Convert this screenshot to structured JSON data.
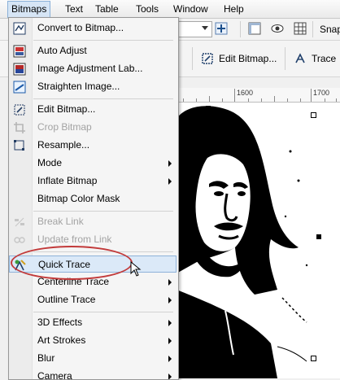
{
  "menubar": {
    "items": [
      {
        "label": "Bitmaps",
        "active": true
      },
      {
        "label": "Text"
      },
      {
        "label": "Table"
      },
      {
        "label": "Tools"
      },
      {
        "label": "Window"
      },
      {
        "label": "Help"
      }
    ]
  },
  "toolbar1": {
    "snap_label": "Snap"
  },
  "toolbar2": {
    "edit_bitmap_label": "Edit Bitmap...",
    "trace_label": "Trace"
  },
  "ruler": {
    "labels": [
      "1600",
      "1700"
    ]
  },
  "menu": {
    "items": [
      {
        "label": "Convert to Bitmap...",
        "icon": "convert-bitmap-icon",
        "disabled": false,
        "submenu": false
      },
      {
        "label": "Auto Adjust",
        "icon": "auto-adjust-icon",
        "disabled": false,
        "submenu": false
      },
      {
        "label": "Image Adjustment Lab...",
        "icon": "image-adjustment-lab-icon",
        "disabled": false,
        "submenu": false
      },
      {
        "label": "Straighten Image...",
        "icon": "straighten-image-icon",
        "disabled": false,
        "submenu": false
      },
      {
        "label": "Edit Bitmap...",
        "icon": "edit-bitmap-icon",
        "disabled": false,
        "submenu": false
      },
      {
        "label": "Crop Bitmap",
        "icon": "crop-bitmap-icon",
        "disabled": true,
        "submenu": false
      },
      {
        "label": "Resample...",
        "icon": "resample-icon",
        "disabled": false,
        "submenu": false
      },
      {
        "label": "Mode",
        "icon": "",
        "disabled": false,
        "submenu": true
      },
      {
        "label": "Inflate Bitmap",
        "icon": "",
        "disabled": false,
        "submenu": true
      },
      {
        "label": "Bitmap Color Mask",
        "icon": "",
        "disabled": false,
        "submenu": false
      },
      {
        "label": "Break Link",
        "icon": "break-link-icon",
        "disabled": true,
        "submenu": false
      },
      {
        "label": "Update from Link",
        "icon": "update-link-icon",
        "disabled": true,
        "submenu": false
      },
      {
        "label": "Quick Trace",
        "icon": "quick-trace-icon",
        "disabled": false,
        "submenu": false,
        "highlighted": true
      },
      {
        "label": "Centerline Trace",
        "icon": "",
        "disabled": false,
        "submenu": true
      },
      {
        "label": "Outline Trace",
        "icon": "",
        "disabled": false,
        "submenu": true
      },
      {
        "label": "3D Effects",
        "icon": "",
        "disabled": false,
        "submenu": true
      },
      {
        "label": "Art Strokes",
        "icon": "",
        "disabled": false,
        "submenu": true
      },
      {
        "label": "Blur",
        "icon": "",
        "disabled": false,
        "submenu": true
      },
      {
        "label": "Camera",
        "icon": "",
        "disabled": false,
        "submenu": true
      }
    ]
  },
  "colors": {
    "highlight_bg": "#dbe9f8",
    "highlight_border": "#8fb2d9",
    "annotation": "#c23a3a"
  }
}
